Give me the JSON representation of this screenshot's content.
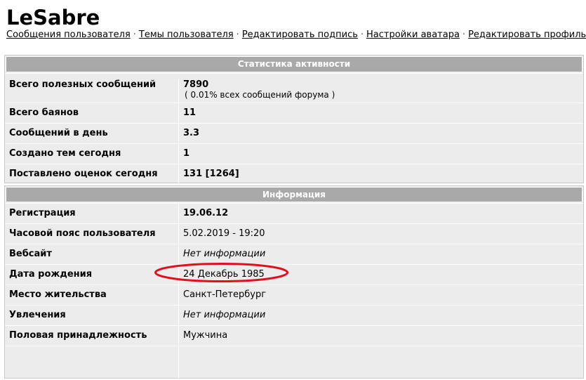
{
  "profile": {
    "username": "LeSabre"
  },
  "nav": {
    "links": [
      "Сообщения пользователя",
      "Темы пользователя",
      "Редактировать подпись",
      "Настройки аватара",
      "Редактировать профиль"
    ],
    "separator": "·"
  },
  "stats": {
    "title": "Статистика активности",
    "rows": [
      {
        "label": "Всего полезных сообщений",
        "value": "7890",
        "sub": "( 0.01% всех сообщений форума )"
      },
      {
        "label": "Всего баянов",
        "value": "11"
      },
      {
        "label": "Сообщений в день",
        "value": "3.3"
      },
      {
        "label": "Создано тем сегодня",
        "value": "1"
      },
      {
        "label": "Поставлено оценок сегодня",
        "value": "131 [1264]"
      }
    ]
  },
  "info": {
    "title": "Информация",
    "rows": [
      {
        "label": "Регистрация",
        "value": "19.06.12"
      },
      {
        "label": "Часовой пояс пользователя",
        "value": "5.02.2019 - 19:20"
      },
      {
        "label": "Вебсайт",
        "value": "Нет информации"
      },
      {
        "label": "Дата рождения",
        "value": "24 Декабрь 1985"
      },
      {
        "label": "Место жительства",
        "value": "Санкт-Петербург"
      },
      {
        "label": "Увлечения",
        "value": "Нет информации"
      },
      {
        "label": "Половая принадлежность",
        "value": "Мужчина"
      }
    ]
  },
  "colors": {
    "header_bg": "#a9a9a9",
    "panel_bg": "#ececec",
    "highlight_ellipse": "#e0101c"
  }
}
